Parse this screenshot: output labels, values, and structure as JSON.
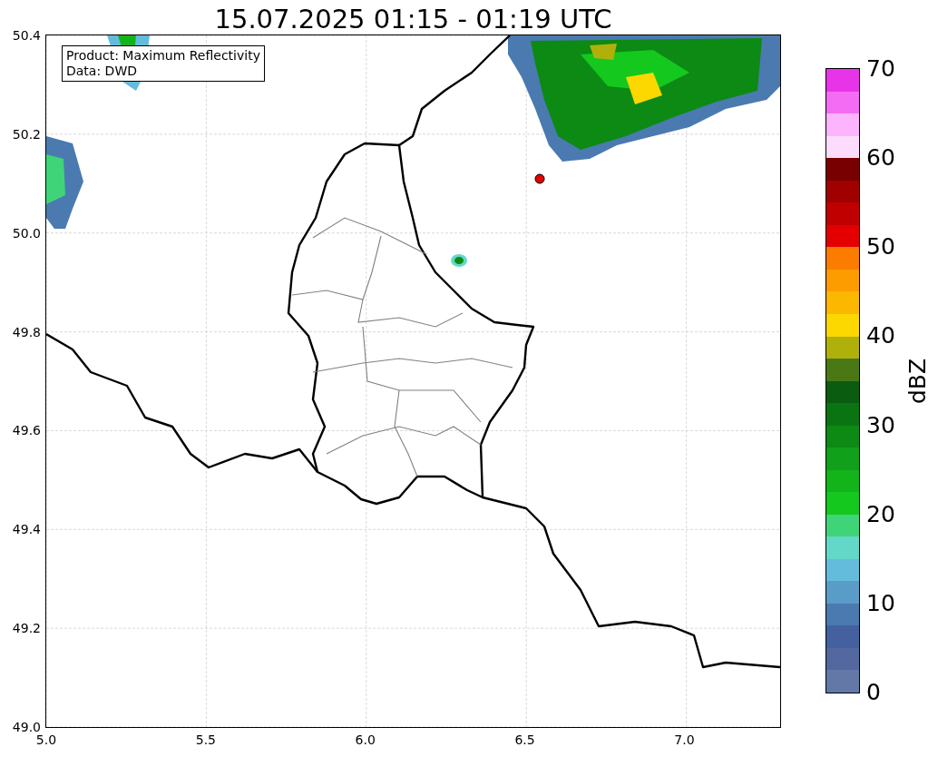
{
  "title": "15.07.2025 01:15 - 01:19 UTC",
  "info": [
    "Product: Maximum Reflectivity",
    "Data: DWD"
  ],
  "map": {
    "x_ticks": [
      "5.0",
      "5.5",
      "6.0",
      "6.5",
      "7.0"
    ],
    "y_ticks": [
      "50.4",
      "50.2",
      "50.0",
      "49.8",
      "49.6",
      "49.4",
      "49.2",
      "49.0"
    ]
  },
  "colorbar": {
    "label": "dBZ",
    "ticks": [
      "70",
      "60",
      "50",
      "40",
      "30",
      "20",
      "10",
      "0"
    ],
    "bins": [
      {
        "color": "#6478a8"
      },
      {
        "color": "#5468a0"
      },
      {
        "color": "#44609e"
      },
      {
        "color": "#4a7ab0"
      },
      {
        "color": "#5a9cc8"
      },
      {
        "color": "#64bcdc"
      },
      {
        "color": "#64d8c8"
      },
      {
        "color": "#40d478"
      },
      {
        "color": "#14c81e"
      },
      {
        "color": "#12b41a"
      },
      {
        "color": "#10a01a"
      },
      {
        "color": "#0c8a14"
      },
      {
        "color": "#0a7412"
      },
      {
        "color": "#0a5c10"
      },
      {
        "color": "#4a7814"
      },
      {
        "color": "#b0b00a"
      },
      {
        "color": "#fcd800"
      },
      {
        "color": "#fcb800"
      },
      {
        "color": "#fc9c00"
      },
      {
        "color": "#fc7c00"
      },
      {
        "color": "#e40000"
      },
      {
        "color": "#c00000"
      },
      {
        "color": "#a00000"
      },
      {
        "color": "#780000"
      },
      {
        "color": "#fcdcfc"
      },
      {
        "color": "#fcb4fc"
      },
      {
        "color": "#f46cf4"
      },
      {
        "color": "#e834e8"
      }
    ]
  }
}
